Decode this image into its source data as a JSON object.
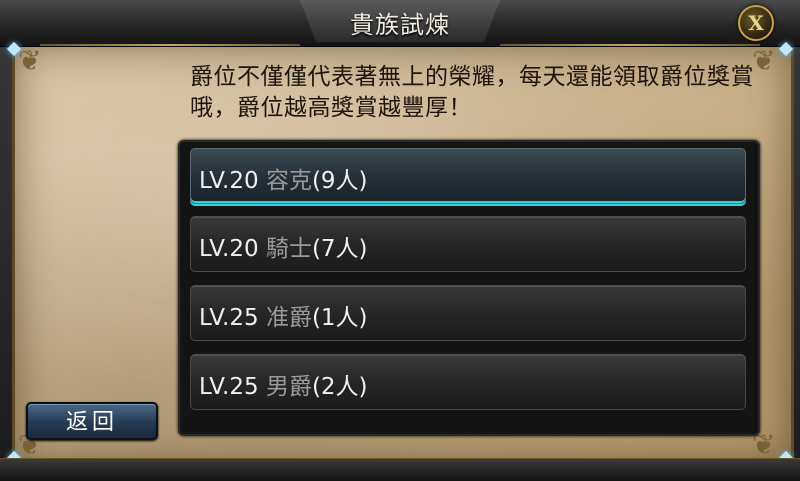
{
  "dialog": {
    "title": "貴族試煉",
    "close_label": "X",
    "description": "爵位不僅僅代表著無上的榮耀，每天還能領取爵位獎賞哦，爵位越高獎賞越豐厚！"
  },
  "ranks": [
    {
      "level": "LV.20",
      "title": "容克",
      "count": "(9人)",
      "selected": true
    },
    {
      "level": "LV.20",
      "title": "騎士",
      "count": "(7人)",
      "selected": false
    },
    {
      "level": "LV.25",
      "title": "准爵",
      "count": "(1人)",
      "selected": false
    },
    {
      "level": "LV.25",
      "title": "男爵",
      "count": "(2人)",
      "selected": false
    }
  ],
  "back_label": "返回",
  "colors": {
    "selected_accent": "#2fd3d9",
    "parchment": "#cdb893",
    "gold": "#c9a95a"
  }
}
